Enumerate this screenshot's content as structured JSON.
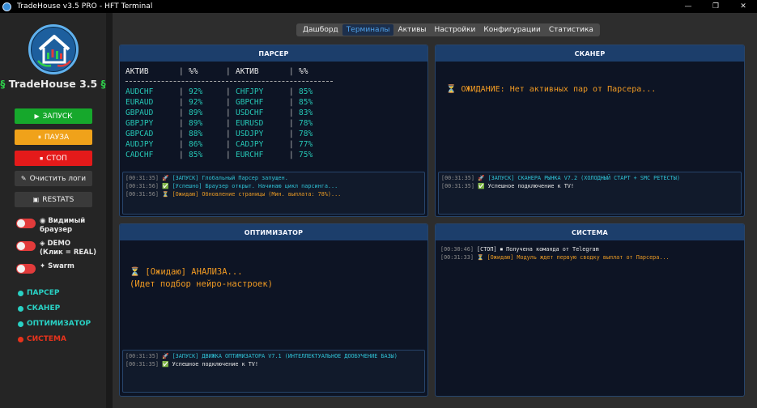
{
  "window": {
    "title": "TradeHouse v3.5 PRO - HFT Terminal",
    "controls": [
      "—",
      "❐",
      "✕"
    ]
  },
  "sidebar": {
    "brand": "TradeHouse 3.5",
    "brand_mark": "§",
    "buttons": {
      "start": "ЗАПУСК",
      "pause": "ПАУЗА",
      "stop": "СТОП",
      "clear": "Очистить логи",
      "restats": "RESTATS"
    },
    "toggles": [
      {
        "label": "Видимый",
        "sub": "браузер"
      },
      {
        "label": "DEMO",
        "sub": "(Клик = REAL)"
      },
      {
        "label": "Swarm",
        "sub": ""
      }
    ],
    "legend": [
      "ПАРСЕР",
      "СКАНЕР",
      "ОПТИМИЗАТОР",
      "СИСТЕМА"
    ],
    "colors": {
      "start": "#16a82c",
      "pause": "#f0a21a",
      "stop": "#e41a1a",
      "active_dot": "#29d1c4",
      "alert_dot": "#e8331c"
    }
  },
  "tabs": [
    "Дашборд",
    "Терминалы",
    "Активы",
    "Настройки",
    "Конфигурации",
    "Статистика"
  ],
  "active_tab": "Терминалы",
  "parser": {
    "title": "ПАРСЕР",
    "headers": [
      "АКТИВ",
      "%%",
      "АКТИВ",
      "%%"
    ],
    "rows": [
      [
        "AUDCHF",
        "92%",
        "CHFJPY",
        "85%"
      ],
      [
        "EURAUD",
        "92%",
        "GBPCHF",
        "85%"
      ],
      [
        "GBPAUD",
        "89%",
        "USDCHF",
        "83%"
      ],
      [
        "GBPJPY",
        "89%",
        "EURUSD",
        "78%"
      ],
      [
        "GBPCAD",
        "88%",
        "USDJPY",
        "78%"
      ],
      [
        "AUDJPY",
        "86%",
        "CADJPY",
        "77%"
      ],
      [
        "CADCHF",
        "85%",
        "EURCHF",
        "75%"
      ]
    ],
    "log": [
      {
        "ts": "[00:31:35]",
        "icon": "🚀",
        "text": "[ЗАПУСК] Глобальный Парсер запущен.",
        "color": "cyan"
      },
      {
        "ts": "[00:31:56]",
        "icon": "✅",
        "text": "[Успешно] Браузер открыт. Начинаю цикл парсинга...",
        "color": "cyan"
      },
      {
        "ts": "[00:31:56]",
        "icon": "⏳",
        "text": "[Ожидаю] Обновление страницы (Мин. выплата: 78%)...",
        "color": "orange"
      }
    ]
  },
  "scanner": {
    "title": "СКАНЕР",
    "waiting": "ОЖИДАНИЕ: Нет активных пар от Парсера...",
    "log": [
      {
        "ts": "[00:31:35]",
        "icon": "🚀",
        "text": "[ЗАПУСК] СКАНЕРА РЫНКА V7.2 (ХОЛОДНЫЙ СТАРТ + SMC РЕТЕСТЫ)",
        "color": "cyan"
      },
      {
        "ts": "[00:31:35]",
        "icon": "✅",
        "text": "Успешное подключение к TV!",
        "color": "white"
      }
    ]
  },
  "optimizer": {
    "title": "ОПТИМИЗАТОР",
    "waiting_line1": "[Ожидаю] АНАЛИЗА...",
    "waiting_line2": "(Идет подбор нейро-настроек)",
    "log": [
      {
        "ts": "[00:31:35]",
        "icon": "🚀",
        "text": "[ЗАПУСК] ДВИЖКА ОПТИМИЗАТОРА V7.1 (ИНТЕЛЛЕКТУАЛЬНОЕ ДООБУЧЕНИЕ БАЗЫ)",
        "color": "cyan"
      },
      {
        "ts": "[00:31:35]",
        "icon": "✅",
        "text": "Успешное подключение к TV!",
        "color": "white"
      }
    ]
  },
  "system": {
    "title": "СИСТЕМА",
    "log": [
      {
        "ts": "[00:30:46]",
        "icon": "",
        "text": "[СТОП] ⏹ Получена команда от Telegram",
        "color": "white"
      },
      {
        "ts": "[00:31:33]",
        "icon": "⏳",
        "text": "[Ожидаю] Модуль ждет первую сводку выплат от Парсера...",
        "color": "orange"
      }
    ]
  }
}
